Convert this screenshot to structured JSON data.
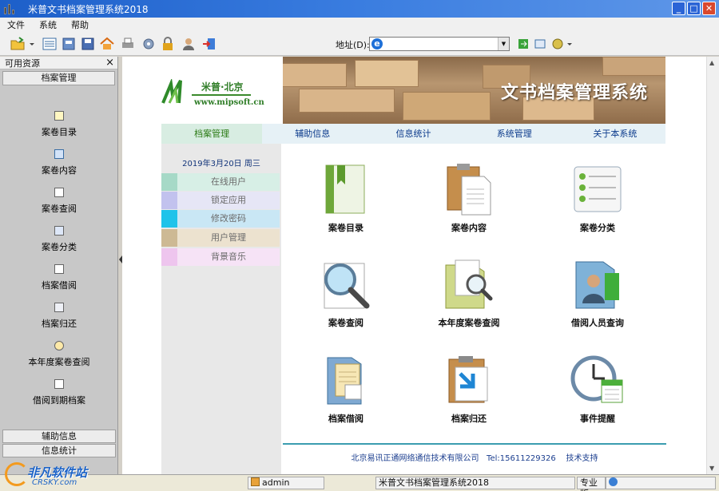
{
  "window": {
    "title": "米普文书档案管理系统2018"
  },
  "menu": [
    "文件",
    "系统",
    "帮助"
  ],
  "toolbar": {
    "icons": [
      "folder-open-icon",
      "list-view-icon",
      "archive-icon",
      "save-icon",
      "home-icon",
      "print-icon",
      "settings-icon",
      "lock-icon",
      "user-icon",
      "exit-icon"
    ],
    "address_label": "地址(D):",
    "address_value": ""
  },
  "left_panel": {
    "header": "可用资源",
    "close": "×",
    "section": "档案管理",
    "items": [
      {
        "label": "案卷目录",
        "icon": "doc-yellow-icon"
      },
      {
        "label": "案卷内容",
        "icon": "grid-icon"
      },
      {
        "label": "案卷查阅",
        "icon": "doc-search-icon"
      },
      {
        "label": "案卷分类",
        "icon": "doc-blue-icon"
      },
      {
        "label": "档案借阅",
        "icon": "doc-borrow-icon"
      },
      {
        "label": "档案归还",
        "icon": "doc-return-icon"
      },
      {
        "label": "本年度案卷查阅",
        "icon": "magnifier-icon"
      },
      {
        "label": "借阅到期档案",
        "icon": "doc-due-icon"
      }
    ],
    "bottom_sections": [
      "辅助信息",
      "信息统计"
    ]
  },
  "page": {
    "logo_text": "米普·北京",
    "logo_url": "www.mipsoft.cn",
    "banner_title": "文书档案管理系统",
    "nav": [
      "档案管理",
      "辅助信息",
      "信息统计",
      "系统管理",
      "关于本系统"
    ],
    "date": "2019年3月20日  周三",
    "side_menu": [
      {
        "label": "在线用户",
        "color": "#a6d9c7",
        "bg": "#d7efe6"
      },
      {
        "label": "锁定应用",
        "color": "#c2c2ee",
        "bg": "#e6e6f6"
      },
      {
        "label": "修改密码",
        "color": "#1fc3ea",
        "bg": "#c9e7f5"
      },
      {
        "label": "用户管理",
        "color": "#cdb994",
        "bg": "#ece2cf"
      },
      {
        "label": "背景音乐",
        "color": "#eec5ee",
        "bg": "#f6e3f6"
      }
    ],
    "grid": [
      {
        "label": "案卷目录",
        "icon": "green-book-icon"
      },
      {
        "label": "案卷内容",
        "icon": "clipboard-doc-icon"
      },
      {
        "label": "案卷分类",
        "icon": "checklist-icon"
      },
      {
        "label": "案卷查阅",
        "icon": "magnifier-doc-icon"
      },
      {
        "label": "本年度案卷查阅",
        "icon": "folder-search-icon"
      },
      {
        "label": "借阅人员查询",
        "icon": "folder-person-icon"
      },
      {
        "label": "档案借阅",
        "icon": "folder-borrow-icon"
      },
      {
        "label": "档案归还",
        "icon": "clipboard-return-icon"
      },
      {
        "label": "事件提醒",
        "icon": "clock-calendar-icon"
      }
    ],
    "footer": "北京易讯正通网络通信技术有限公司   Tel:15611229326    技术支持"
  },
  "statusbar": {
    "user": "admin",
    "app": "米普文书档案管理系统2018",
    "edition": "专业版",
    "watermark_cn": "非凡软件站",
    "watermark_en": "CRSKY.com"
  }
}
